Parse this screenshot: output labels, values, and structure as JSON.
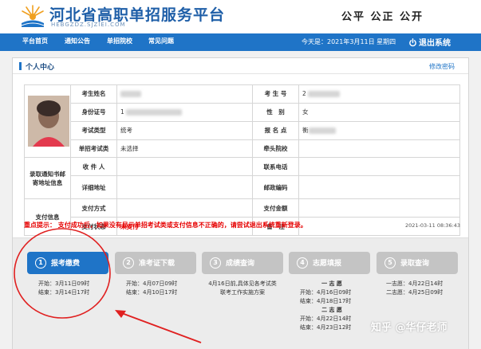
{
  "header": {
    "title": "河北省高职单招服务平台",
    "url": "HEBGZDZ.SJZIEI.COM",
    "slogan": "公平 公正 公开"
  },
  "nav": {
    "items": [
      "平台首页",
      "通知公告",
      "单招院校",
      "常见问题"
    ],
    "date": "今天是：2021年3月11日 星期四",
    "logout": "退出系统"
  },
  "panel": {
    "title": "个人中心",
    "change_password": "修改密码"
  },
  "info": {
    "name_label": "考生姓名",
    "exam_no_label": "考 生 号",
    "exam_no_prefix": "2",
    "id_label": "身份证号",
    "id_prefix": "1",
    "gender_label": "性　别",
    "gender": "女",
    "type_label": "考试类型",
    "type": "统考",
    "site_label": "报 名 点",
    "site_prefix": "衡",
    "category_label": "单招考试类",
    "category": "未选择",
    "lead_label": "牵头院校",
    "mail_section": "录取通知书邮寄地址信息",
    "receiver_label": "收 件 人",
    "phone_label": "联系电话",
    "address_label": "详细地址",
    "zip_label": "邮政编码",
    "pay_section": "支付信息",
    "pay_method_label": "支付方式",
    "pay_amount_label": "支付金额",
    "pay_status_label": "支付状态",
    "pay_status": "未支付",
    "remark_label": "备　注"
  },
  "notice": {
    "text": "重点提示： 支付成功后，如果没有显示单招考试类或支付信息不正确的，请尝试退出系统重新登录。",
    "time": "2021-03-11 08:36:43"
  },
  "steps": [
    {
      "num": "1",
      "label": "报考缴费",
      "active": true
    },
    {
      "num": "2",
      "label": "准考证下载",
      "active": false
    },
    {
      "num": "3",
      "label": "成绩查询",
      "active": false
    },
    {
      "num": "4",
      "label": "志愿填报",
      "active": false
    },
    {
      "num": "5",
      "label": "录取查询",
      "active": false
    }
  ],
  "step_info": {
    "s1": [
      "开始：3月11日09时",
      "结束：3月14日17时"
    ],
    "s2": [
      "开始：4月07日09时",
      "结束：4月10日17时"
    ],
    "s3": [
      "4月16日前,具体见各考试类",
      "联考工作实施方案"
    ],
    "s4_head1": "一 志 愿",
    "s4_first": [
      "开始：4月16日09时",
      "结束：4月18日17时"
    ],
    "s4_head2": "二 志 愿",
    "s4_second": [
      "开始：4月22日14时",
      "结束：4月23日12时"
    ],
    "s5": [
      "一志愿：4月22日14时",
      "二志愿：4月25日09时"
    ]
  },
  "watermark": "知乎 @华仔老师",
  "colors": {
    "brand": "#1f74c7",
    "title": "#1f5fa8",
    "alert": "#e60000",
    "inactive_step": "#c4c4c4",
    "annotation": "#e02020"
  }
}
